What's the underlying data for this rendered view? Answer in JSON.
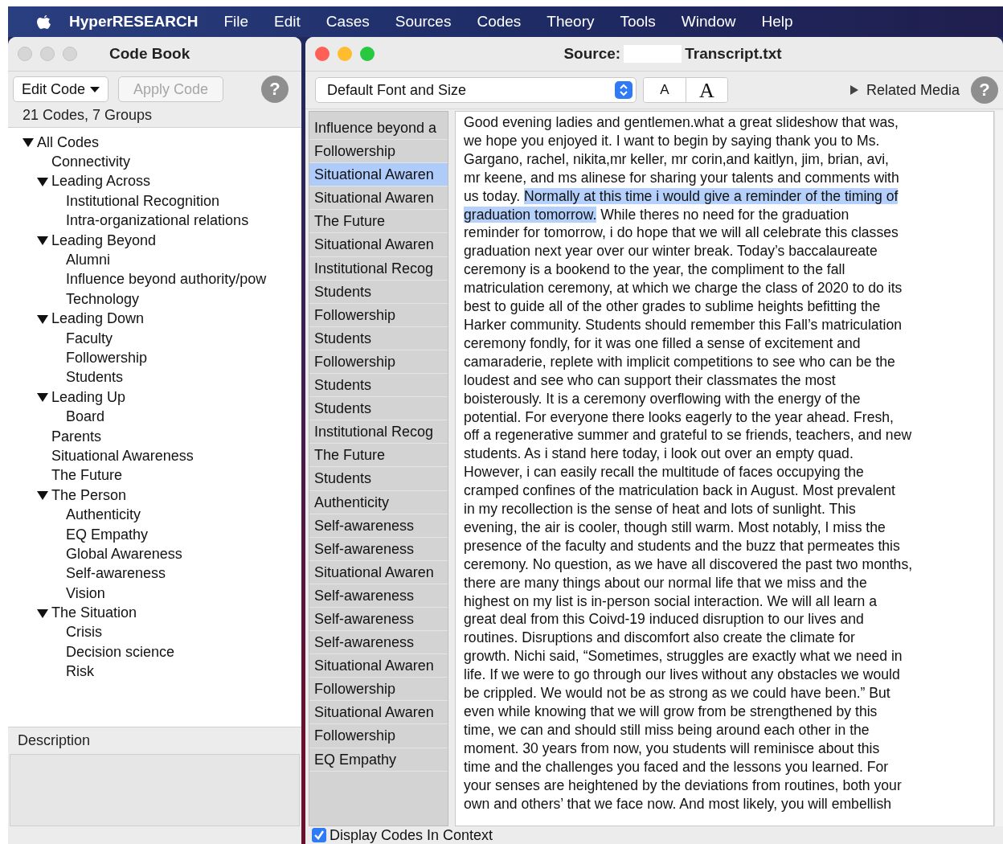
{
  "menu_bar": {
    "app": "HyperRESEARCH",
    "items": [
      "File",
      "Edit",
      "Cases",
      "Sources",
      "Codes",
      "Theory",
      "Tools",
      "Window",
      "Help"
    ]
  },
  "code_book": {
    "title": "Code Book",
    "edit_button": "Edit Code",
    "apply_button": {
      "label": "Apply Code",
      "disabled": true
    },
    "help": "?",
    "summary": "21 Codes, 7 Groups",
    "tree": [
      {
        "label": "All Codes",
        "expanded": true,
        "children": [
          {
            "label": "Connectivity"
          },
          {
            "label": "Leading Across",
            "expanded": true,
            "children": [
              {
                "label": "Institutional Recognition"
              },
              {
                "label": "Intra-organizational relations"
              }
            ]
          },
          {
            "label": "Leading Beyond",
            "expanded": true,
            "children": [
              {
                "label": "Alumni"
              },
              {
                "label": "Influence beyond authority/pow"
              },
              {
                "label": "Technology"
              }
            ]
          },
          {
            "label": "Leading Down",
            "expanded": true,
            "children": [
              {
                "label": "Faculty"
              },
              {
                "label": "Followership"
              },
              {
                "label": "Students"
              }
            ]
          },
          {
            "label": "Leading Up",
            "expanded": true,
            "children": [
              {
                "label": "Board"
              }
            ]
          },
          {
            "label": "Parents"
          },
          {
            "label": "Situational Awareness"
          },
          {
            "label": "The Future"
          },
          {
            "label": "The Person",
            "expanded": true,
            "children": [
              {
                "label": "Authenticity"
              },
              {
                "label": "EQ Empathy"
              },
              {
                "label": "Global Awareness"
              },
              {
                "label": "Self-awareness"
              },
              {
                "label": "Vision"
              }
            ]
          },
          {
            "label": "The Situation",
            "expanded": true,
            "children": [
              {
                "label": "Crisis"
              },
              {
                "label": "Decision science"
              },
              {
                "label": "Risk"
              }
            ]
          }
        ]
      }
    ],
    "description_label": "Description"
  },
  "source_window": {
    "title_label": "Source:",
    "title_file": "Transcript.txt",
    "font_select": "Default Font and Size",
    "font_smaller": "A",
    "font_larger": "A",
    "related_media": "Related Media",
    "help": "?",
    "codes": [
      {
        "label": "Influence beyond a",
        "selected": false
      },
      {
        "label": "Followership",
        "selected": false
      },
      {
        "label": "Situational Awaren",
        "selected": true
      },
      {
        "label": "Situational Awaren",
        "selected": false
      },
      {
        "label": "The Future",
        "selected": false
      },
      {
        "label": "Situational Awaren",
        "selected": false
      },
      {
        "label": "Institutional Recog",
        "selected": false
      },
      {
        "label": "Students",
        "selected": false
      },
      {
        "label": "Followership",
        "selected": false
      },
      {
        "label": "Students",
        "selected": false
      },
      {
        "label": "Followership",
        "selected": false
      },
      {
        "label": "Students",
        "selected": false
      },
      {
        "label": "Students",
        "selected": false
      },
      {
        "label": "Institutional Recog",
        "selected": false
      },
      {
        "label": "The Future",
        "selected": false
      },
      {
        "label": "Students",
        "selected": false
      },
      {
        "label": "Authenticity",
        "selected": false
      },
      {
        "label": "Self-awareness",
        "selected": false
      },
      {
        "label": "Self-awareness",
        "selected": false
      },
      {
        "label": "Situational Awaren",
        "selected": false
      },
      {
        "label": "Self-awareness",
        "selected": false
      },
      {
        "label": "Self-awareness",
        "selected": false
      },
      {
        "label": "Self-awareness",
        "selected": false
      },
      {
        "label": "Situational Awaren",
        "selected": false
      },
      {
        "label": "Followership",
        "selected": false
      },
      {
        "label": "Situational Awaren",
        "selected": false
      },
      {
        "label": "Followership",
        "selected": false
      },
      {
        "label": "EQ Empathy",
        "selected": false
      }
    ],
    "text_lines": [
      [
        {
          "text": "Good evening ladies and gentlemen.what a great slideshow that was,",
          "selected": false
        }
      ],
      [
        {
          "text": "we hope you enjoyed it. I want to begin by saying thank you to Ms.",
          "selected": false
        }
      ],
      [
        {
          "text": "Gargano, rachel, nikita,mr keller, mr corin,and kaitlyn, jim, brian, avi,",
          "selected": false
        }
      ],
      [
        {
          "text": "mr keene, and ms alinese for sharing your talents and comments with",
          "selected": false
        }
      ],
      [
        {
          "text": "us today. ",
          "selected": false
        },
        {
          "text": "Normally at this time i would give a reminder of the timing of",
          "selected": true
        }
      ],
      [
        {
          "text": "graduation tomorrow.",
          "selected": true
        },
        {
          "text": " While theres no need for the graduation",
          "selected": false
        }
      ],
      [
        {
          "text": "reminder for tomorrow, i do hope that we will all celebrate this classes",
          "selected": false
        }
      ],
      [
        {
          "text": "graduation next year over our winter break. Today’s baccalaureate",
          "selected": false
        }
      ],
      [
        {
          "text": "ceremony is a bookend to the year, the compliment to the fall",
          "selected": false
        }
      ],
      [
        {
          "text": "matriculation ceremony, at which we charge the class of 2020 to do its",
          "selected": false
        }
      ],
      [
        {
          "text": "best to guide all of the other grades to sublime heights befitting the",
          "selected": false
        }
      ],
      [
        {
          "text": "Harker community.  Students should remember this Fall’s matriculation",
          "selected": false
        }
      ],
      [
        {
          "text": "ceremony fondly, for it was one filled a sense of excitement and",
          "selected": false
        }
      ],
      [
        {
          "text": "camaraderie, replete with implicit competitions to see who can be the",
          "selected": false
        }
      ],
      [
        {
          "text": "loudest and see who can support their classmates the most",
          "selected": false
        }
      ],
      [
        {
          "text": "boisterously. It is a ceremony overflowing with the energy of the",
          "selected": false
        }
      ],
      [
        {
          "text": "potential. For everyone there looks eagerly to the year ahead.  Fresh,",
          "selected": false
        }
      ],
      [
        {
          "text": "off a regenerative summer and grateful to se friends, teachers, and new",
          "selected": false
        }
      ],
      [
        {
          "text": "students.  As i stand here today, i look out over an empty quad.",
          "selected": false
        }
      ],
      [
        {
          "text": "However, i can easily recall the multitude of faces occupying the",
          "selected": false
        }
      ],
      [
        {
          "text": "cramped confines of the matriculation back in August. Most prevalent",
          "selected": false
        }
      ],
      [
        {
          "text": "in my recollection is the sense of heat and lots of sunlight.  This",
          "selected": false
        }
      ],
      [
        {
          "text": "evening, the air is cooler, though still warm.  Most notably, I miss the",
          "selected": false
        }
      ],
      [
        {
          "text": "presence of the faculty and students and the buzz that permeates this",
          "selected": false
        }
      ],
      [
        {
          "text": "ceremony. No question, as we have all discovered the past two months,",
          "selected": false
        }
      ],
      [
        {
          "text": "there are many things about our normal life that we miss and the",
          "selected": false
        }
      ],
      [
        {
          "text": "highest on my list is in-person social interaction. We will all learn a",
          "selected": false
        }
      ],
      [
        {
          "text": "great deal from this Coivd-19 induced disruption to our lives and",
          "selected": false
        }
      ],
      [
        {
          "text": "routines.  Disruptions and discomfort also create the climate for",
          "selected": false
        }
      ],
      [
        {
          "text": "growth. Nichi said, “Sometimes, struggles are exactly what we need in",
          "selected": false
        }
      ],
      [
        {
          "text": "life.  If we were to go through our lives without any obstacles we would",
          "selected": false
        }
      ],
      [
        {
          "text": "be crippled.  We would not be as strong as we could have been.” But",
          "selected": false
        }
      ],
      [
        {
          "text": "even while knowing that we will grow from be strengthened by this",
          "selected": false
        }
      ],
      [
        {
          "text": "time, we can and should still miss being around each other in the",
          "selected": false
        }
      ],
      [
        {
          "text": "moment. 30 years from now, you students will reminisce about this",
          "selected": false
        }
      ],
      [
        {
          "text": "time and the challenges you faced and the lessons you learned. For",
          "selected": false
        }
      ],
      [
        {
          "text": "your senses are heightened by the deviations from routines, both your",
          "selected": false
        }
      ],
      [
        {
          "text": "own and others’ that we face now. And most likely, you will embellish",
          "selected": false
        }
      ]
    ],
    "display_codes": {
      "label": "Display Codes In Context",
      "checked": true
    }
  }
}
